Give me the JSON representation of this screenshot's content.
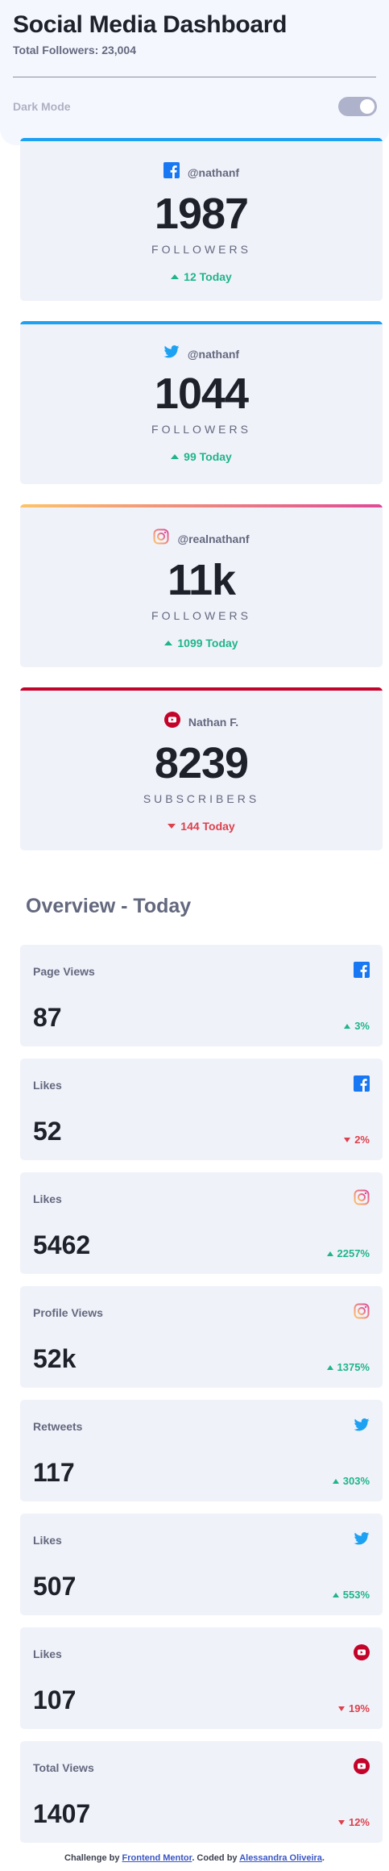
{
  "header": {
    "title": "Social Media Dashboard",
    "total_followers": "Total Followers: 23,004",
    "dark_mode_label": "Dark Mode"
  },
  "cards": [
    {
      "platform": "facebook",
      "icon": "facebook-icon",
      "handle": "@nathanf",
      "count": "1987",
      "unit": "FOLLOWERS",
      "today": "12 Today",
      "trend": "up"
    },
    {
      "platform": "twitter",
      "icon": "twitter-icon",
      "handle": "@nathanf",
      "count": "1044",
      "unit": "FOLLOWERS",
      "today": "99 Today",
      "trend": "up"
    },
    {
      "platform": "instagram",
      "icon": "instagram-icon",
      "handle": "@realnathanf",
      "count": "11k",
      "unit": "FOLLOWERS",
      "today": "1099 Today",
      "trend": "up"
    },
    {
      "platform": "youtube",
      "icon": "youtube-icon",
      "handle": "Nathan F.",
      "count": "8239",
      "unit": "SUBSCRIBERS",
      "today": "144 Today",
      "trend": "down"
    }
  ],
  "overview": {
    "title": "Overview - Today",
    "items": [
      {
        "label": "Page Views",
        "icon": "facebook-icon",
        "value": "87",
        "pct": "3%",
        "trend": "up"
      },
      {
        "label": "Likes",
        "icon": "facebook-icon",
        "value": "52",
        "pct": "2%",
        "trend": "down"
      },
      {
        "label": "Likes",
        "icon": "instagram-icon",
        "value": "5462",
        "pct": "2257%",
        "trend": "up"
      },
      {
        "label": "Profile Views",
        "icon": "instagram-icon",
        "value": "52k",
        "pct": "1375%",
        "trend": "up"
      },
      {
        "label": "Retweets",
        "icon": "twitter-icon",
        "value": "117",
        "pct": "303%",
        "trend": "up"
      },
      {
        "label": "Likes",
        "icon": "twitter-icon",
        "value": "507",
        "pct": "553%",
        "trend": "up"
      },
      {
        "label": "Likes",
        "icon": "youtube-icon",
        "value": "107",
        "pct": "19%",
        "trend": "down"
      },
      {
        "label": "Total Views",
        "icon": "youtube-icon",
        "value": "1407",
        "pct": "12%",
        "trend": "down"
      }
    ]
  },
  "footer": {
    "prefix": "Challenge by ",
    "link1": "Frontend Mentor",
    "middle": ". Coded by ",
    "link2": "Alessandra Oliveira",
    "suffix": "."
  },
  "colors": {
    "facebook": "#1877f2",
    "twitter": "#1da1f2",
    "instagram": "#e4405f",
    "youtube": "#c4032a",
    "up": "#1eb589",
    "down": "#dc414c"
  }
}
